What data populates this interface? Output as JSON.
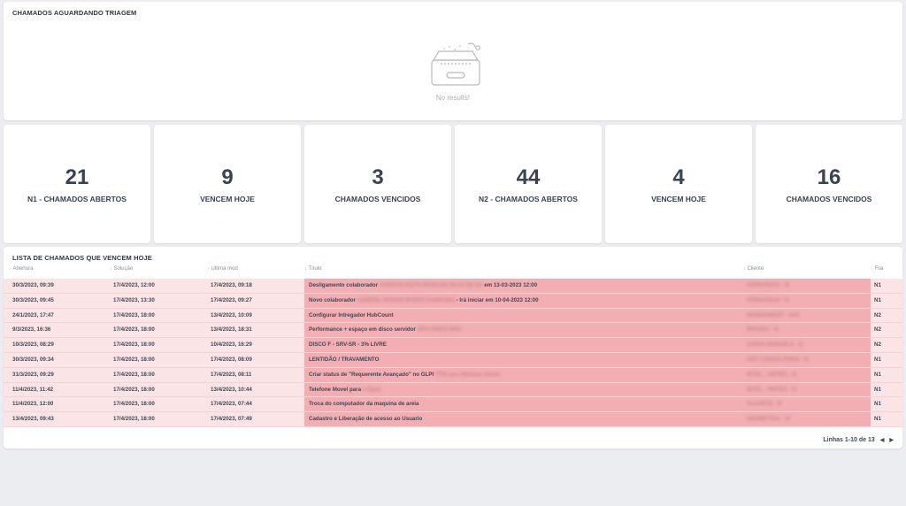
{
  "triage": {
    "title": "CHAMADOS AGUARDANDO TRIAGEM",
    "empty_text": "No results!",
    "empty_icon": "empty-box-icon"
  },
  "kpis": [
    {
      "value": "21",
      "label": "N1 - CHAMADOS ABERTOS"
    },
    {
      "value": "9",
      "label": "VENCEM HOJE"
    },
    {
      "value": "3",
      "label": "CHAMADOS VENCIDOS"
    },
    {
      "value": "44",
      "label": "N2 - CHAMADOS ABERTOS"
    },
    {
      "value": "4",
      "label": "VENCEM HOJE"
    },
    {
      "value": "16",
      "label": "CHAMADOS VENCIDOS"
    }
  ],
  "list": {
    "title": "LISTA DE CHAMADOS QUE VENCEM HOJE",
    "columns": [
      "Abertura",
      "Solução",
      "Ultima mod",
      "Título",
      "Cliente",
      "Fila"
    ],
    "rows": [
      {
        "abertura": "30/3/2023, 09:39",
        "solucao": "17/4/2023, 12:00",
        "ultima": "17/4/2023, 09:18",
        "titulo": "Desligamento colaborador",
        "titulo_hidden": "CHRISTE EDITH ROSA DA SILVA DE SÁ",
        "titulo_after": "em 13-03-2023 12:00",
        "cliente": "FERRATECK - N",
        "fila": "N1"
      },
      {
        "abertura": "30/3/2023, 09:45",
        "solucao": "17/4/2023, 13:30",
        "ultima": "17/4/2023, 09:27",
        "titulo": "Novo colaborador",
        "titulo_hidden": "GABRIEL MARON BUENO SAMPONA",
        "titulo_after": "- Irá iniciar em 10-04-2023 12:00",
        "cliente": "FERRATECK - N",
        "fila": "N1"
      },
      {
        "abertura": "24/1/2023, 17:47",
        "solucao": "17/4/2023, 18:00",
        "ultima": "13/4/2023, 10:09",
        "titulo": "Configurar Intregador HubCount",
        "titulo_hidden": "",
        "titulo_after": "",
        "cliente": "INGENAMENT - XXX",
        "fila": "N2"
      },
      {
        "abertura": "9/3/2023, 16:36",
        "solucao": "17/4/2023, 18:00",
        "ultima": "13/4/2023, 18:31",
        "titulo": "Performance + espaço em disco servidor",
        "titulo_hidden": "SRV-VM01S-BRU",
        "titulo_after": "",
        "cliente": "BRAVEC - N",
        "fila": "N2"
      },
      {
        "abertura": "10/3/2023, 08:29",
        "solucao": "17/4/2023, 18:00",
        "ultima": "10/4/2023, 16:29",
        "titulo": "DISCO F - SRV-SR - 3% LIVRE",
        "titulo_hidden": "",
        "titulo_after": "",
        "cliente": "SANTA MARCELA - N",
        "fila": "N2"
      },
      {
        "abertura": "30/3/2023, 09:34",
        "solucao": "17/4/2023, 18:00",
        "ultima": "17/4/2023, 08:09",
        "titulo": "LENTIDÃO / TRAVAMENTO",
        "titulo_hidden": "",
        "titulo_after": "",
        "cliente": "GRT CONSULTORIA - N",
        "fila": "N1"
      },
      {
        "abertura": "31/3/2023, 09:29",
        "solucao": "17/4/2023, 18:00",
        "ultima": "17/4/2023, 08:11",
        "titulo": "Criar status de \"Requerente Avançado\" no GLPI",
        "titulo_hidden": "FPW para Bárbara Moser",
        "titulo_after": "",
        "cliente": "INTEL - VINTEC - N",
        "fila": "N1"
      },
      {
        "abertura": "11/4/2023, 11:42",
        "solucao": "17/4/2023, 18:00",
        "ultima": "13/4/2023, 10:44",
        "titulo": "Telefone Movel para",
        "titulo_hidden": "o Egon",
        "titulo_after": "",
        "cliente": "INTEL - VINTEC - N",
        "fila": "N1"
      },
      {
        "abertura": "11/4/2023, 12:00",
        "solucao": "17/4/2023, 18:00",
        "ultima": "17/4/2023, 07:44",
        "titulo": "Troca do computador da maquina de areia",
        "titulo_hidden": "",
        "titulo_after": "",
        "cliente": "ALUARTE - N",
        "fila": "N1"
      },
      {
        "abertura": "13/4/2023, 09:43",
        "solucao": "17/4/2023, 18:00",
        "ultima": "17/4/2023, 07:49",
        "titulo": "Cadastro e Liberação de acesso ao Usuario",
        "titulo_hidden": "",
        "titulo_after": "",
        "cliente": "SEGMETRAL - N",
        "fila": "N1"
      }
    ],
    "pagination": "Linhas 1-10 de 13",
    "prev_icon": "chevron-left-icon",
    "next_icon": "chevron-right-icon"
  },
  "colors": {
    "row_bg": "#fbe4e6",
    "highlight_bg": "#f2aeb2",
    "page_bg": "#ebedf0"
  }
}
